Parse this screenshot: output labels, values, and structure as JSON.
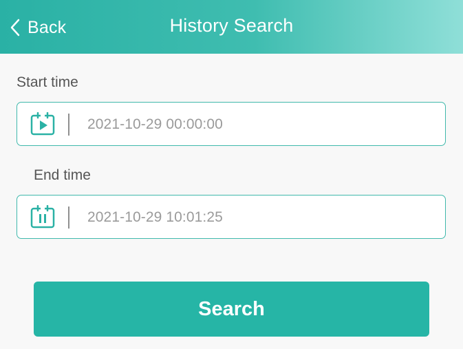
{
  "header": {
    "back_label": "Back",
    "title": "History Search"
  },
  "start": {
    "label": "Start time",
    "value": "2021-10-29 00:00:00",
    "icon": "calendar-play-icon"
  },
  "end": {
    "label": "End time",
    "value": "2021-10-29 10:01:25",
    "icon": "calendar-pause-icon"
  },
  "search_button": "Search",
  "colors": {
    "accent": "#26b5a6",
    "border": "#3fb8ab",
    "header_start": "#2ab1a5",
    "header_end": "#8fdfd8"
  }
}
